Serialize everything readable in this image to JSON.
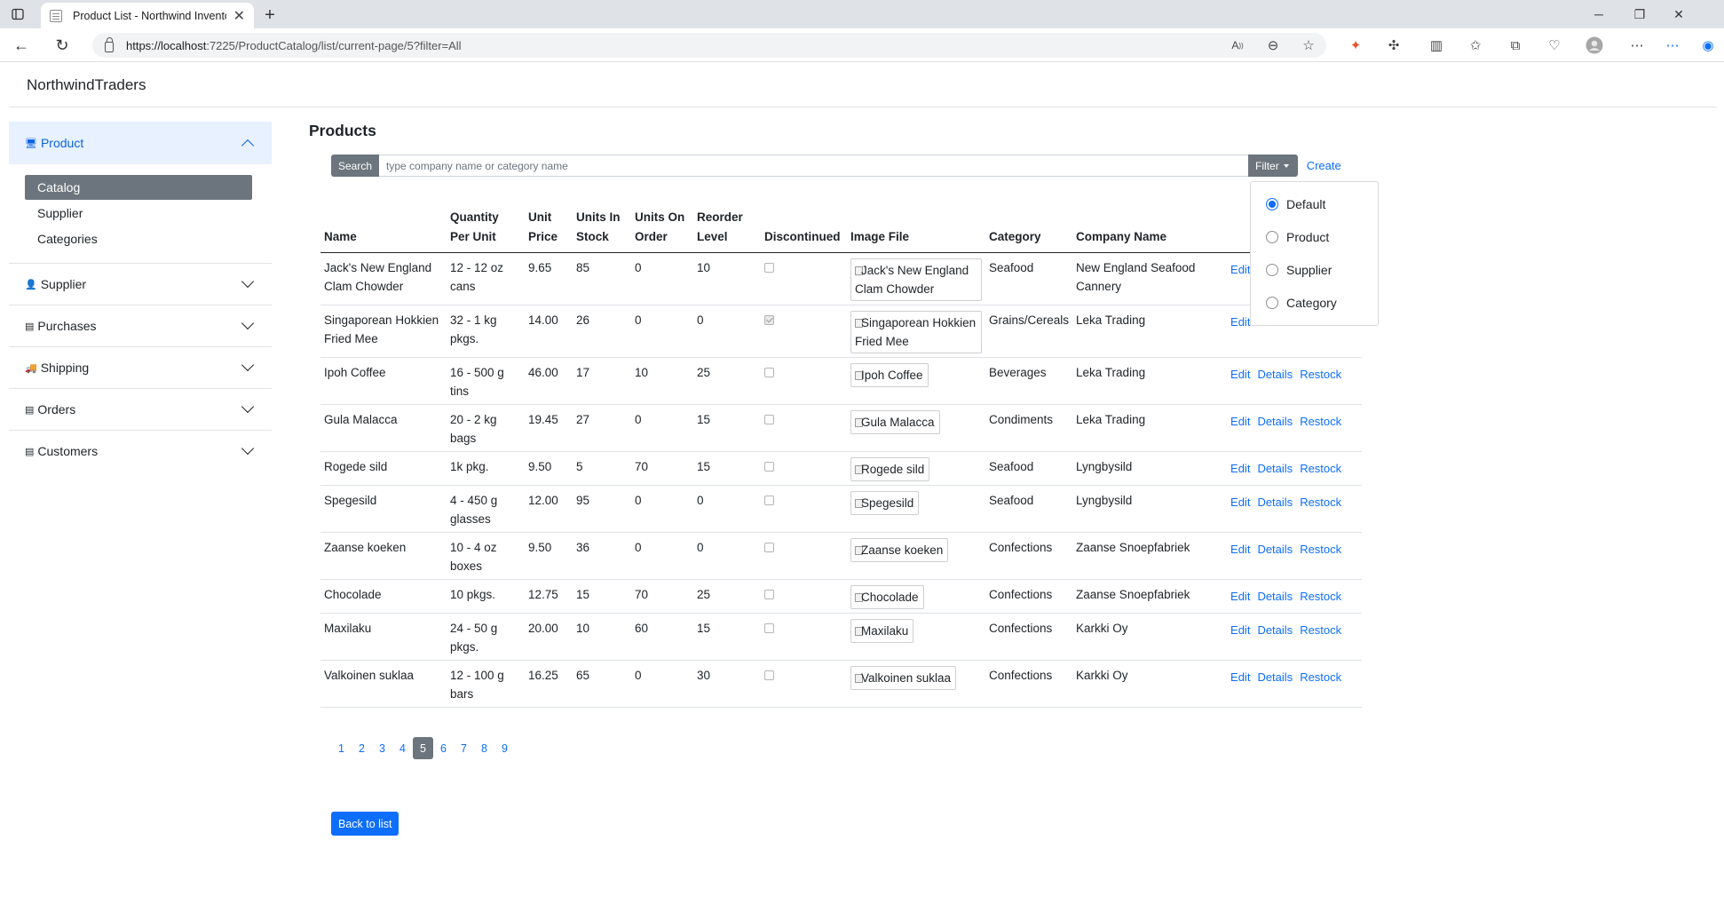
{
  "browser": {
    "tab_title": "Product List - Northwind Invento",
    "url_host": "https://localhost",
    "url_path": ":7225/ProductCatalog/list/current-page/5?filter=All"
  },
  "brand": "NorthwindTraders",
  "sidebar": {
    "sections": [
      {
        "label": "Product",
        "icon": "product-icon"
      },
      {
        "label": "Supplier",
        "icon": "supplier-icon"
      },
      {
        "label": "Purchases",
        "icon": "purchases-icon"
      },
      {
        "label": "Shipping",
        "icon": "shipping-icon"
      },
      {
        "label": "Orders",
        "icon": "orders-icon"
      },
      {
        "label": "Customers",
        "icon": "customers-icon"
      }
    ],
    "product_items": [
      "Catalog",
      "Supplier",
      "Categories"
    ]
  },
  "page": {
    "title": "Products",
    "search_label": "Search",
    "search_placeholder": "type company name or category name",
    "filter_label": "Filter",
    "create_label": "Create",
    "back_label": "Back to list"
  },
  "filter_options": [
    {
      "label": "Default",
      "checked": true
    },
    {
      "label": "Product",
      "checked": false
    },
    {
      "label": "Supplier",
      "checked": false
    },
    {
      "label": "Category",
      "checked": false
    }
  ],
  "table": {
    "headers": {
      "name": "Name",
      "qty_1": "Quantity",
      "qty_2": "Per Unit",
      "price_1": "Unit",
      "price_2": "Price",
      "stock_1": "Units In",
      "stock_2": "Stock",
      "order_1": "Units On",
      "order_2": "Order",
      "reorder_1": "Reorder",
      "reorder_2": "Level",
      "discontinued": "Discontinued",
      "image": "Image File",
      "category": "Category",
      "company": "Company Name"
    },
    "action_labels": {
      "edit": "Edit",
      "details": "Details",
      "restock": "Restock"
    },
    "rows": [
      {
        "name": "Jack's New England Clam Chowder",
        "qty": "12 - 12 oz cans",
        "price": "9.65",
        "stock": "85",
        "order": "0",
        "reorder": "10",
        "discontinued": false,
        "image": "Jack's New England Clam Chowder",
        "category": "Seafood",
        "company": "New England Seafood Cannery"
      },
      {
        "name": "Singaporean Hokkien Fried Mee",
        "qty": "32 - 1 kg pkgs.",
        "price": "14.00",
        "stock": "26",
        "order": "0",
        "reorder": "0",
        "discontinued": true,
        "image": "Singaporean Hokkien Fried Mee",
        "category": "Grains/Cereals",
        "company": "Leka Trading"
      },
      {
        "name": "Ipoh Coffee",
        "qty": "16 - 500 g tins",
        "price": "46.00",
        "stock": "17",
        "order": "10",
        "reorder": "25",
        "discontinued": false,
        "image": "Ipoh Coffee",
        "category": "Beverages",
        "company": "Leka Trading"
      },
      {
        "name": "Gula Malacca",
        "qty": "20 - 2 kg bags",
        "price": "19.45",
        "stock": "27",
        "order": "0",
        "reorder": "15",
        "discontinued": false,
        "image": "Gula Malacca",
        "category": "Condiments",
        "company": "Leka Trading"
      },
      {
        "name": "Rogede sild",
        "qty": "1k pkg.",
        "price": "9.50",
        "stock": "5",
        "order": "70",
        "reorder": "15",
        "discontinued": false,
        "image": "Rogede sild",
        "category": "Seafood",
        "company": "Lyngbysild"
      },
      {
        "name": "Spegesild",
        "qty": "4 - 450 g glasses",
        "price": "12.00",
        "stock": "95",
        "order": "0",
        "reorder": "0",
        "discontinued": false,
        "image": "Spegesild",
        "category": "Seafood",
        "company": "Lyngbysild"
      },
      {
        "name": "Zaanse koeken",
        "qty": "10 - 4 oz boxes",
        "price": "9.50",
        "stock": "36",
        "order": "0",
        "reorder": "0",
        "discontinued": false,
        "image": "Zaanse koeken",
        "category": "Confections",
        "company": "Zaanse Snoepfabriek"
      },
      {
        "name": "Chocolade",
        "qty": "10 pkgs.",
        "price": "12.75",
        "stock": "15",
        "order": "70",
        "reorder": "25",
        "discontinued": false,
        "image": "Chocolade",
        "category": "Confections",
        "company": "Zaanse Snoepfabriek"
      },
      {
        "name": "Maxilaku",
        "qty": "24 - 50 g pkgs.",
        "price": "20.00",
        "stock": "10",
        "order": "60",
        "reorder": "15",
        "discontinued": false,
        "image": "Maxilaku",
        "category": "Confections",
        "company": "Karkki Oy"
      },
      {
        "name": "Valkoinen suklaa",
        "qty": "12 - 100 g bars",
        "price": "16.25",
        "stock": "65",
        "order": "0",
        "reorder": "30",
        "discontinued": false,
        "image": "Valkoinen suklaa",
        "category": "Confections",
        "company": "Karkki Oy"
      }
    ]
  },
  "pagination": {
    "pages": [
      "1",
      "2",
      "3",
      "4",
      "5",
      "6",
      "7",
      "8",
      "9"
    ],
    "current": "5"
  }
}
